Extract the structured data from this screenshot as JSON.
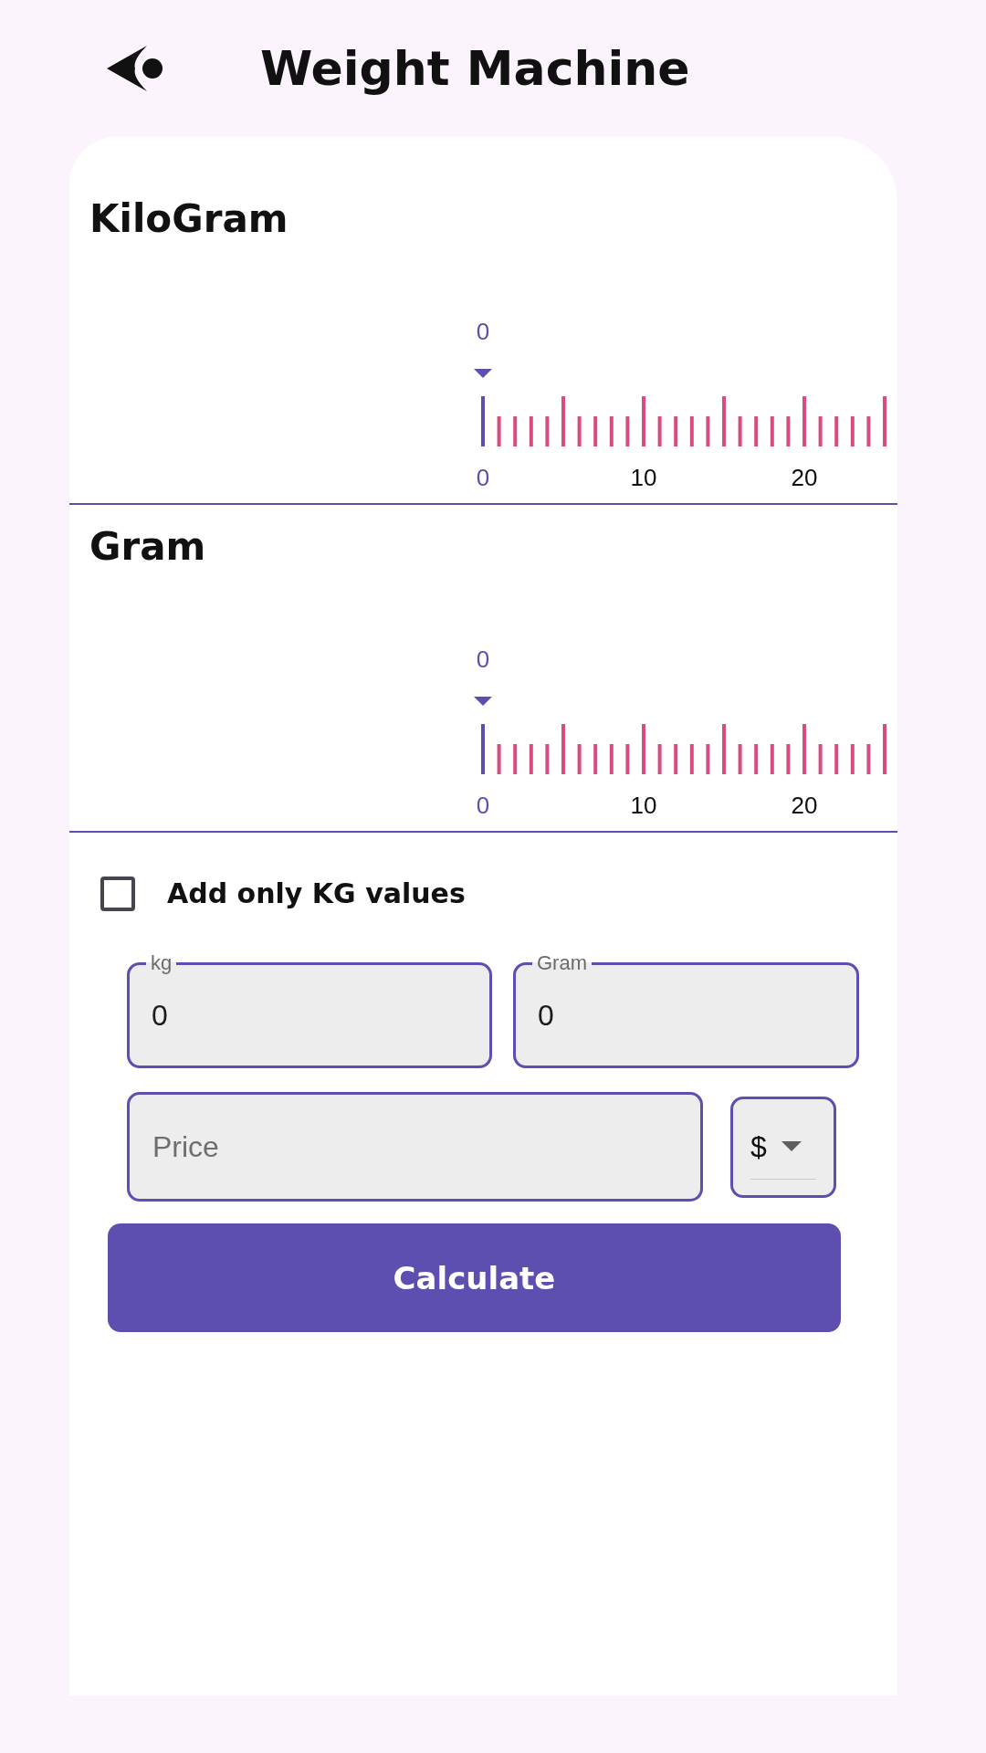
{
  "app_bar": {
    "title": "Weight Machine"
  },
  "rulers": [
    {
      "label": "KiloGram",
      "value": "0",
      "tick_labels": [
        {
          "text": "0",
          "selected": true
        },
        {
          "text": "10",
          "selected": false
        },
        {
          "text": "20",
          "selected": false
        }
      ]
    },
    {
      "label": "Gram",
      "value": "0",
      "tick_labels": [
        {
          "text": "0",
          "selected": true
        },
        {
          "text": "10",
          "selected": false
        },
        {
          "text": "20",
          "selected": false
        }
      ]
    }
  ],
  "only_kg_checkbox": {
    "label": "Add only KG values",
    "checked": false
  },
  "weight_fields": [
    {
      "label": "kg",
      "value": "0"
    },
    {
      "label": "Gram",
      "value": "0"
    }
  ],
  "price_field": {
    "placeholder": "Price"
  },
  "currency_dropdown": {
    "value": "$"
  },
  "calculate_button": {
    "label": "Calculate"
  }
}
